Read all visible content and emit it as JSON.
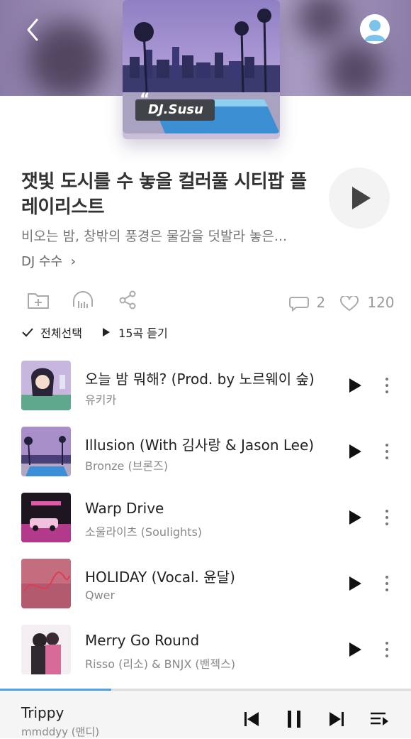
{
  "header": {
    "back_icon": "chevron-left-icon",
    "profile_icon": "user-avatar-icon",
    "cover_badge": "DJ.Susu",
    "cover_quote": "“"
  },
  "playlist": {
    "title": "잿빛 도시를 수 놓을 컬러풀 시티팝 플레이리스트",
    "subtitle": "비오는 밤, 창밖의 풍경은 물감을 덧발라 놓은...",
    "dj_name": "DJ 수수",
    "dj_chevron": "›"
  },
  "actions": {
    "add_folder_icon": "folder-plus-icon",
    "listen_icon": "headphones-icon",
    "share_icon": "share-icon",
    "comment_icon": "comment-icon",
    "comment_count": "2",
    "like_icon": "heart-icon",
    "like_count": "120"
  },
  "selection": {
    "select_all_label": "전체선택",
    "play_all_label": "15곡 듣기"
  },
  "tracks": [
    {
      "title": "오늘 밤 뭐해? (Prod. by 노르웨이 숲)",
      "artist": "유키카"
    },
    {
      "title": "Illusion (With 김사랑 & Jason Lee)",
      "artist": "Bronze (브론즈)"
    },
    {
      "title": "Warp Drive",
      "artist": "소울라이츠 (Soulights)"
    },
    {
      "title": "HOLIDAY (Vocal. 윤달)",
      "artist": "Qwer"
    },
    {
      "title": "Merry Go Round",
      "artist": "Risso (리소) & BNJX (밴젝스)"
    }
  ],
  "player": {
    "title": "Trippy",
    "artist": "mmddyy (맨디)",
    "progress_fraction": 0.27,
    "accent_color": "#4da3e0"
  }
}
